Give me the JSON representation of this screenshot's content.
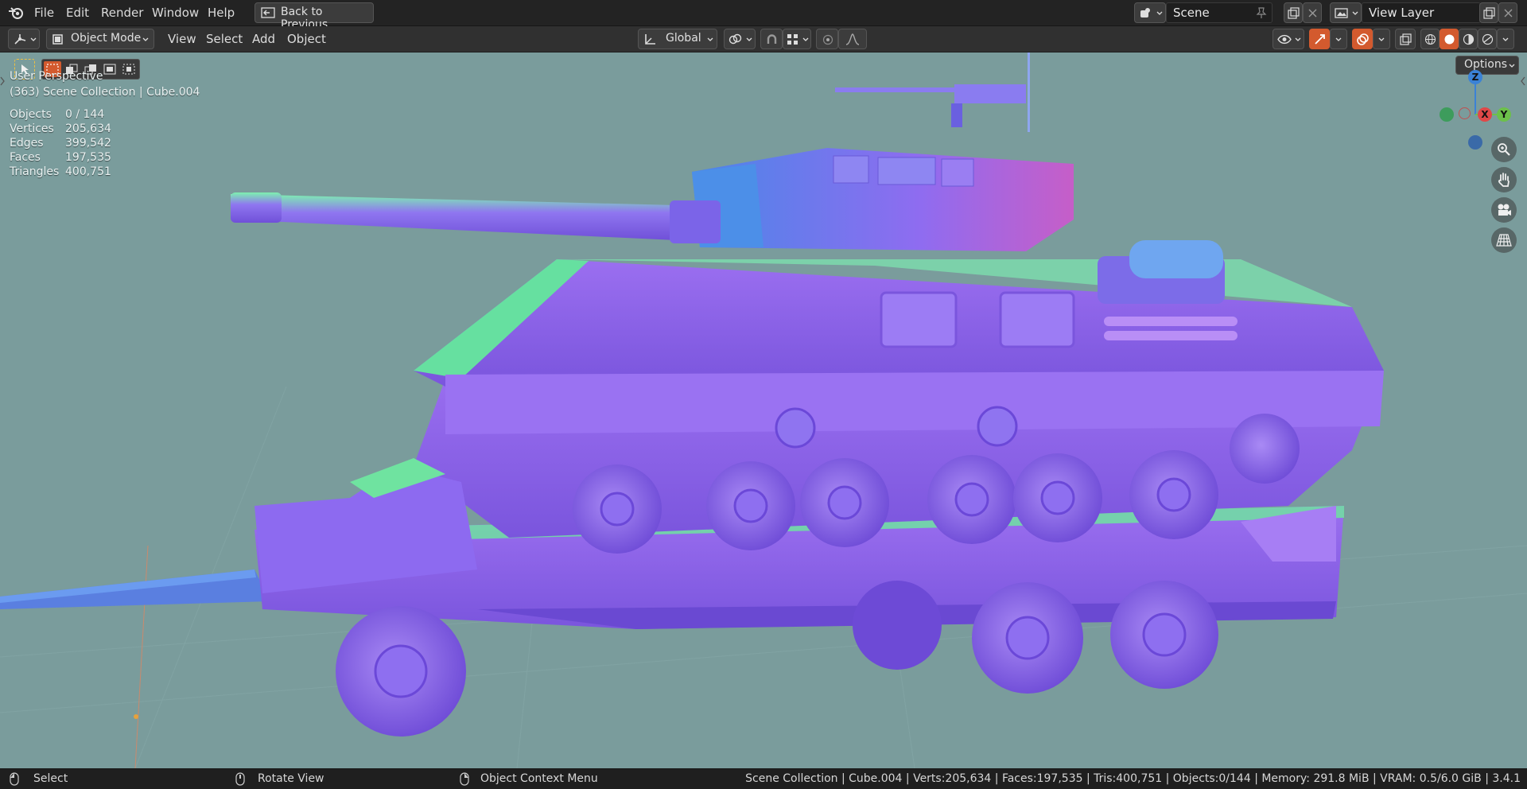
{
  "menu": {
    "items": [
      "File",
      "Edit",
      "Render",
      "Window",
      "Help"
    ],
    "back_label": "Back to Previous"
  },
  "scene": {
    "label": "Scene"
  },
  "view_layer": {
    "label": "View Layer"
  },
  "header": {
    "mode": "Object Mode",
    "menus": [
      "View",
      "Select",
      "Add",
      "Object"
    ],
    "transform_orientation": "Global",
    "options_label": "Options"
  },
  "viewport": {
    "perspective": "User Perspective",
    "collection": "(363) Scene Collection | Cube.004",
    "stats": [
      {
        "label": "Objects",
        "value": "0 / 144"
      },
      {
        "label": "Vertices",
        "value": "205,634"
      },
      {
        "label": "Edges",
        "value": "399,542"
      },
      {
        "label": "Faces",
        "value": "197,535"
      },
      {
        "label": "Triangles",
        "value": "400,751"
      }
    ],
    "gizmo": {
      "z": "Z",
      "x": "X",
      "y": "Y"
    },
    "colors": {
      "background": "#7a9c9c",
      "x_axis": "#e04848",
      "y_axis": "#6cc04a",
      "z_axis": "#3b82d6"
    }
  },
  "status": {
    "select": "Select",
    "rotate": "Rotate View",
    "context": "Object Context Menu",
    "info": "Scene Collection | Cube.004 | Verts:205,634 | Faces:197,535 | Tris:400,751 | Objects:0/144 | Memory: 291.8 MiB | VRAM: 0.5/6.0 GiB | 3.4.1"
  }
}
